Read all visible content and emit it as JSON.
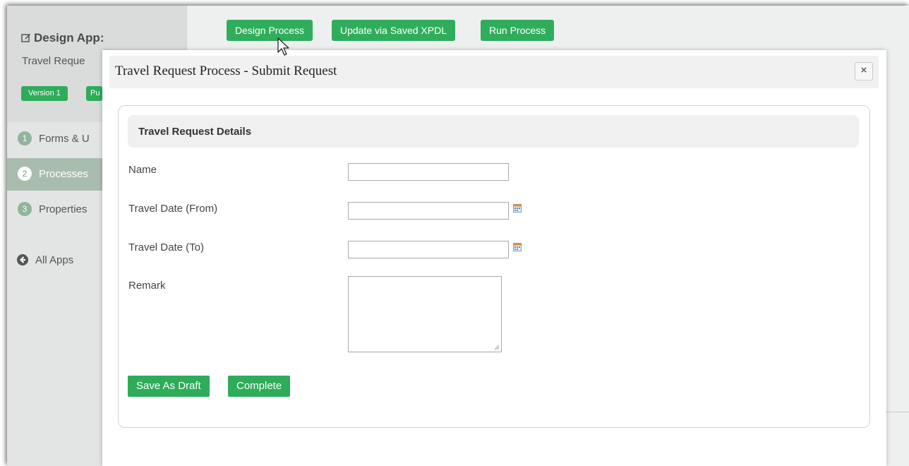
{
  "sidebar": {
    "app_title": "Design App:",
    "app_subtitle": "Travel Reque",
    "version_pills": [
      "Version 1",
      "Pu"
    ],
    "nav_items": [
      {
        "num": "1",
        "label": "Forms & U"
      },
      {
        "num": "2",
        "label": "Processes"
      },
      {
        "num": "3",
        "label": "Properties"
      }
    ],
    "all_apps_label": "All Apps"
  },
  "toolbar": {
    "design_process": "Design Process",
    "update_xpdl": "Update via Saved XPDL",
    "run_process": "Run Process"
  },
  "modal": {
    "title": "Travel Request Process - Submit Request",
    "close_glyph": "×",
    "section_title": "Travel Request Details",
    "fields": [
      {
        "label": "Name",
        "value": ""
      },
      {
        "label": "Travel Date (From)",
        "value": ""
      },
      {
        "label": "Travel Date (To)",
        "value": ""
      },
      {
        "label": "Remark",
        "value": ""
      }
    ],
    "buttons": {
      "save_draft": "Save As Draft",
      "complete": "Complete"
    }
  },
  "colors": {
    "accent_green": "#2eac5a",
    "sidebar_bg": "#e3e5e4",
    "active_nav": "#a9bdaf"
  },
  "icons": [
    "edit-icon",
    "back-arrow-icon",
    "calendar-icon",
    "close-icon",
    "mouse-cursor-icon"
  ]
}
